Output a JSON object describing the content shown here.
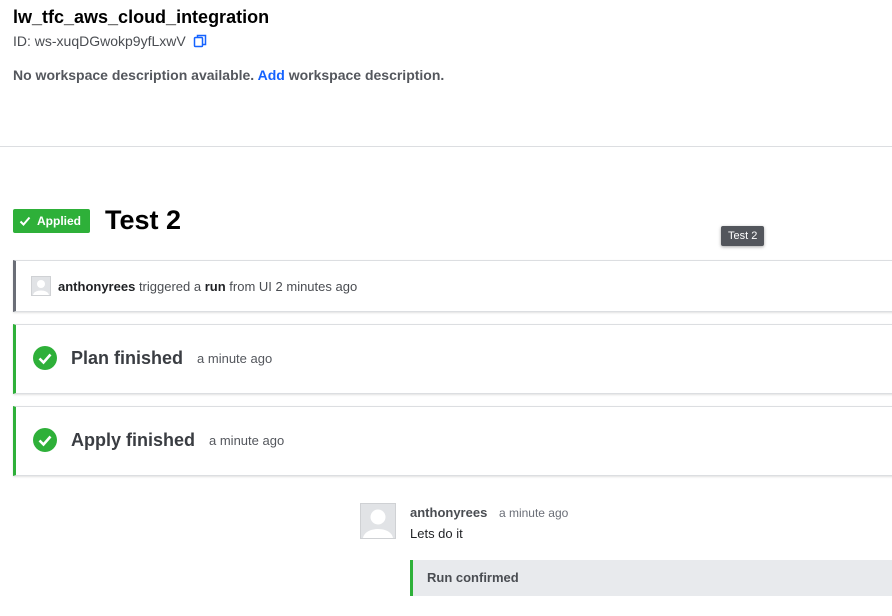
{
  "workspace": {
    "title": "lw_tfc_aws_cloud_integration",
    "id_label": "ID: ws-xuqDGwokp9yfLxwV",
    "description_prefix": "No workspace description available.",
    "description_link": "Add",
    "description_suffix": "workspace description."
  },
  "run": {
    "status": "Applied",
    "title": "Test 2",
    "tooltip": "Test 2"
  },
  "trigger": {
    "user": "anthonyrees",
    "text1": "triggered a",
    "run_word": "run",
    "text2": "from UI 2 minutes ago"
  },
  "plan": {
    "label": "Plan finished",
    "time": "a minute ago"
  },
  "apply": {
    "label": "Apply finished",
    "time": "a minute ago"
  },
  "comment": {
    "author": "anthonyrees",
    "time": "a minute ago",
    "text": "Lets do it",
    "confirmation": "Run confirmed"
  },
  "colors": {
    "success": "#2eb039",
    "link": "#1563ff",
    "tooltip_bg": "#53565c"
  },
  "icons": {
    "copy": "copy-icon",
    "check": "check-icon",
    "check_circle": "check-circle-icon",
    "avatar": "user-avatar"
  }
}
